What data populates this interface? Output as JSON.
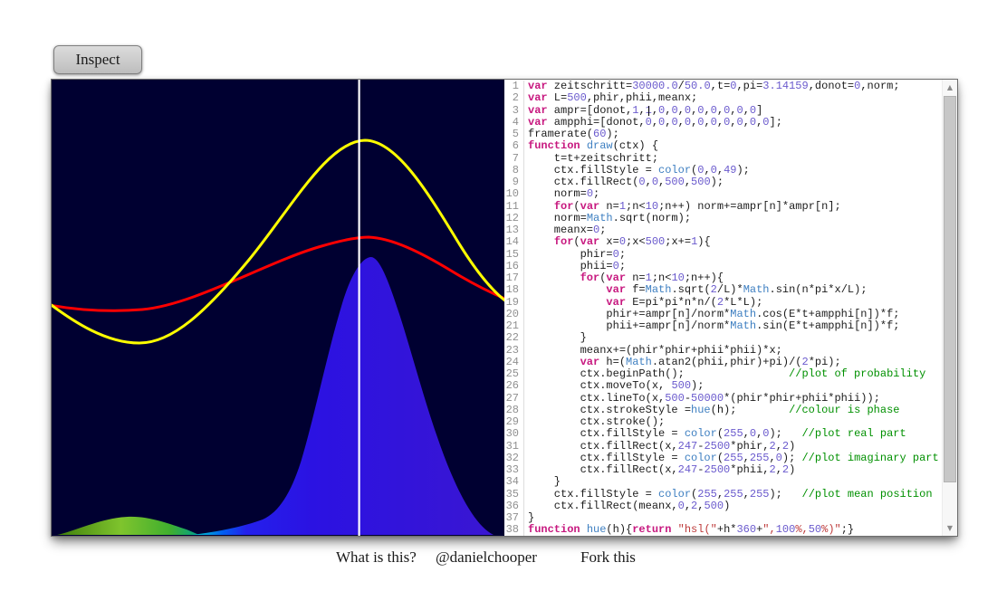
{
  "toolbar": {
    "inspect_label": "Inspect"
  },
  "footer": {
    "links": [
      "What is this?",
      "@danielchooper",
      "Fork this"
    ]
  },
  "canvas": {
    "background": "#000031",
    "colors": {
      "real_part": "#ff0000",
      "imaginary_part": "#ffff00",
      "mean_position": "#ffffff",
      "probability_blue": "#2b12e2",
      "probability_green": "#7fc42d",
      "probability_teal": "#00c2c2"
    }
  },
  "editor": {
    "cursor": {
      "line": 3,
      "col": 19
    },
    "keywords": [
      "var",
      "function",
      "for",
      "return"
    ],
    "builtins": [
      "Math",
      "color",
      "draw",
      "hue"
    ],
    "colors": {
      "keyword": "#c7187f",
      "builtin": "#3e7fc1",
      "number": "#6a5acd",
      "string": "#be3b3b",
      "comment": "#009000",
      "text": "#1c1c1c",
      "line_number": "#909090",
      "divider": "#dddddd",
      "background": "#ffffff"
    },
    "lines": [
      "var zeitschritt=30000.0/50.0,t=0,pi=3.14159,donot=0,norm;",
      "var L=500,phir,phii,meanx;",
      "var ampr=[donot,1,1,0,0,0,0,0,0,0,0]",
      "var ampphi=[donot,0,0,0,0,0,0,0,0,0,0];",
      "framerate(60);",
      "function draw(ctx) {",
      "    t=t+zeitschritt;",
      "    ctx.fillStyle = color(0,0,49);",
      "    ctx.fillRect(0,0,500,500);",
      "    norm=0;",
      "    for(var n=1;n<10;n++) norm+=ampr[n]*ampr[n];",
      "    norm=Math.sqrt(norm);",
      "    meanx=0;",
      "    for(var x=0;x<500;x+=1){",
      "        phir=0;",
      "        phii=0;",
      "        for(var n=1;n<10;n++){",
      "            var f=Math.sqrt(2/L)*Math.sin(n*pi*x/L);",
      "            var E=pi*pi*n*n/(2*L*L);",
      "            phir+=ampr[n]/norm*Math.cos(E*t+ampphi[n])*f;",
      "            phii+=ampr[n]/norm*Math.sin(E*t+ampphi[n])*f;",
      "        }",
      "        meanx+=(phir*phir+phii*phii)*x;",
      "        var h=(Math.atan2(phii,phir)+pi)/(2*pi);",
      "        ctx.beginPath();                //plot of probability",
      "        ctx.moveTo(x, 500);",
      "        ctx.lineTo(x,500-50000*(phir*phir+phii*phii));",
      "        ctx.strokeStyle =hue(h);        //colour is phase",
      "        ctx.stroke();",
      "        ctx.fillStyle = color(255,0,0);   //plot real part",
      "        ctx.fillRect(x,247-2500*phir,2,2)",
      "        ctx.fillStyle = color(255,255,0); //plot imaginary part",
      "        ctx.fillRect(x,247-2500*phii,2,2)",
      "    }",
      "    ctx.fillStyle = color(255,255,255);   //plot mean position",
      "    ctx.fillRect(meanx,0,2,500)",
      "}",
      "function hue(h){return \"hsl(\"+h*360+\",100%,50%)\";}"
    ],
    "scrollbar": {
      "up_glyph": "▲",
      "down_glyph": "▼"
    }
  }
}
